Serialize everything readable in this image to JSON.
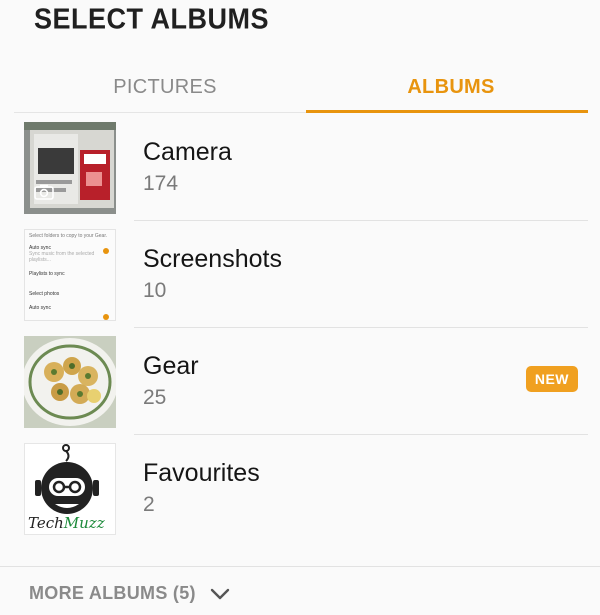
{
  "header": {
    "title": "SELECT ALBUMS"
  },
  "tabs": [
    {
      "label": "PICTURES",
      "active": false
    },
    {
      "label": "ALBUMS",
      "active": true
    }
  ],
  "albums": [
    {
      "name": "Camera",
      "count": "174",
      "icon": "camera-icon"
    },
    {
      "name": "Screenshots",
      "count": "10"
    },
    {
      "name": "Gear",
      "count": "25",
      "badge": "NEW"
    },
    {
      "name": "Favourites",
      "count": "2"
    }
  ],
  "thumbnails": {
    "screenshots": {
      "line1": "Select folders to copy to your Gear.",
      "line2": "Auto sync",
      "line3": "Playlists to sync",
      "line4": "Select photos",
      "line5": "Auto sync"
    },
    "favourites": {
      "logo_text": "TechMuzz"
    }
  },
  "footer": {
    "more_label": "MORE ALBUMS (5)"
  },
  "colors": {
    "accent": "#e8940e",
    "badge": "#f0a020"
  }
}
